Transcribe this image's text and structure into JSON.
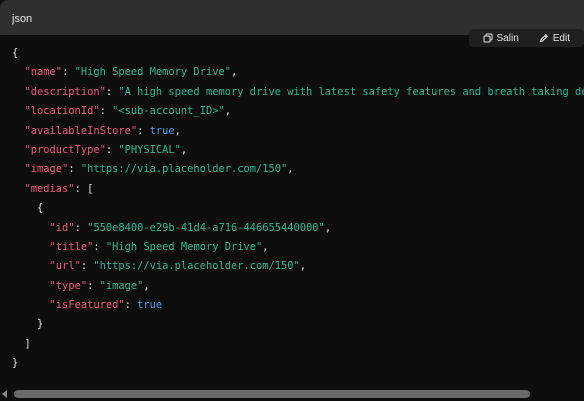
{
  "header": {
    "language": "json",
    "copy_label": "Salin",
    "edit_label": "Edit"
  },
  "code": {
    "lines": [
      [
        {
          "t": "p",
          "v": "{"
        }
      ],
      [
        {
          "t": "p",
          "v": "  "
        },
        {
          "t": "k",
          "v": "\"name\""
        },
        {
          "t": "p",
          "v": ": "
        },
        {
          "t": "s",
          "v": "\"High Speed Memory Drive\""
        },
        {
          "t": "p",
          "v": ","
        }
      ],
      [
        {
          "t": "p",
          "v": "  "
        },
        {
          "t": "k",
          "v": "\"description\""
        },
        {
          "t": "p",
          "v": ": "
        },
        {
          "t": "s",
          "v": "\"A high speed memory drive with latest safety features and breath taking des"
        }
      ],
      [
        {
          "t": "p",
          "v": "  "
        },
        {
          "t": "k",
          "v": "\"locationId\""
        },
        {
          "t": "p",
          "v": ": "
        },
        {
          "t": "s",
          "v": "\"<sub-account_ID>\""
        },
        {
          "t": "p",
          "v": ","
        }
      ],
      [
        {
          "t": "p",
          "v": "  "
        },
        {
          "t": "k",
          "v": "\"availableInStore\""
        },
        {
          "t": "p",
          "v": ": "
        },
        {
          "t": "b",
          "v": "true"
        },
        {
          "t": "p",
          "v": ","
        }
      ],
      [
        {
          "t": "p",
          "v": "  "
        },
        {
          "t": "k",
          "v": "\"productType\""
        },
        {
          "t": "p",
          "v": ": "
        },
        {
          "t": "s",
          "v": "\"PHYSICAL\""
        },
        {
          "t": "p",
          "v": ","
        }
      ],
      [
        {
          "t": "p",
          "v": "  "
        },
        {
          "t": "k",
          "v": "\"image\""
        },
        {
          "t": "p",
          "v": ": "
        },
        {
          "t": "s",
          "v": "\"https://via.placeholder.com/150\""
        },
        {
          "t": "p",
          "v": ","
        }
      ],
      [
        {
          "t": "p",
          "v": "  "
        },
        {
          "t": "k",
          "v": "\"medias\""
        },
        {
          "t": "p",
          "v": ": ["
        }
      ],
      [
        {
          "t": "p",
          "v": "    {"
        }
      ],
      [
        {
          "t": "p",
          "v": "      "
        },
        {
          "t": "k",
          "v": "\"id\""
        },
        {
          "t": "p",
          "v": ": "
        },
        {
          "t": "s",
          "v": "\"550e8400-e29b-41d4-a716-446655440000\""
        },
        {
          "t": "p",
          "v": ","
        }
      ],
      [
        {
          "t": "p",
          "v": "      "
        },
        {
          "t": "k",
          "v": "\"title\""
        },
        {
          "t": "p",
          "v": ": "
        },
        {
          "t": "s",
          "v": "\"High Speed Memory Drive\""
        },
        {
          "t": "p",
          "v": ","
        }
      ],
      [
        {
          "t": "p",
          "v": "      "
        },
        {
          "t": "k",
          "v": "\"url\""
        },
        {
          "t": "p",
          "v": ": "
        },
        {
          "t": "s",
          "v": "\"https://via.placeholder.com/150\""
        },
        {
          "t": "p",
          "v": ","
        }
      ],
      [
        {
          "t": "p",
          "v": "      "
        },
        {
          "t": "k",
          "v": "\"type\""
        },
        {
          "t": "p",
          "v": ": "
        },
        {
          "t": "s",
          "v": "\"image\""
        },
        {
          "t": "p",
          "v": ","
        }
      ],
      [
        {
          "t": "p",
          "v": "      "
        },
        {
          "t": "k",
          "v": "\"isFeatured\""
        },
        {
          "t": "p",
          "v": ": "
        },
        {
          "t": "b",
          "v": "true"
        }
      ],
      [
        {
          "t": "p",
          "v": "    }"
        }
      ],
      [
        {
          "t": "p",
          "v": "  ]"
        }
      ],
      [
        {
          "t": "p",
          "v": "}"
        }
      ]
    ]
  },
  "colors": {
    "key": "#f05b7d",
    "string": "#2fb99a",
    "boolean": "#4f9ee8",
    "text": "#e6e6e6",
    "background": "#0d0d0d",
    "header_background": "#2f2f2f"
  },
  "icons": {
    "copy": "copy-icon",
    "edit": "edit-icon"
  }
}
